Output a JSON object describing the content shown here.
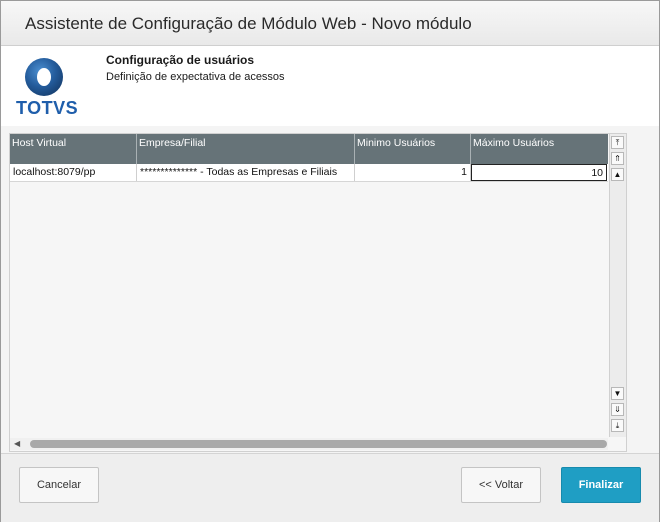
{
  "window": {
    "title": "Assistente de Configuração de Módulo Web - Novo módulo"
  },
  "header": {
    "logo_text": "TOTVS",
    "title": "Configuração de usuários",
    "subtitle": "Definição de expectativa de acessos"
  },
  "grid": {
    "columns": [
      "Host Virtual",
      "Empresa/Filial",
      "Minimo Usuários",
      "Máximo Usuários"
    ],
    "rows": [
      [
        "localhost:8079/pp",
        "************** - Todas as Empresas e Filiais",
        "1",
        "10"
      ]
    ]
  },
  "scroll": {
    "up_icons": [
      "scroll-top-icon",
      "scroll-page-up-icon",
      "scroll-up-icon"
    ],
    "down_icons": [
      "scroll-down-icon",
      "scroll-page-down-icon",
      "scroll-bottom-icon"
    ]
  },
  "footer": {
    "cancel_label": "Cancelar",
    "back_label": "<< Voltar",
    "finish_label": "Finalizar"
  },
  "colors": {
    "header_bg": "#667378",
    "primary_button": "#1f9ec4",
    "brand": "#1f5eab"
  }
}
